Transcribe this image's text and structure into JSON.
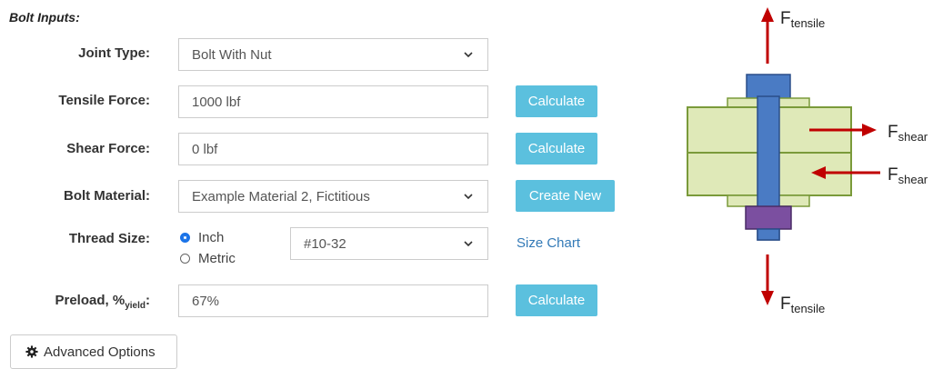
{
  "section_title": "Bolt Inputs:",
  "joint_type": {
    "label": "Joint Type:",
    "value": "Bolt With Nut"
  },
  "tensile_force": {
    "label": "Tensile Force:",
    "value": "1000 lbf",
    "button": "Calculate"
  },
  "shear_force": {
    "label": "Shear Force:",
    "value": "0 lbf",
    "button": "Calculate"
  },
  "bolt_material": {
    "label": "Bolt Material:",
    "value": "Example Material 2, Fictitious",
    "button": "Create New"
  },
  "thread_size": {
    "label": "Thread Size:",
    "radio_inch": "Inch",
    "radio_metric": "Metric",
    "selected_unit": "Inch",
    "value": "#10-32",
    "link": "Size Chart"
  },
  "preload": {
    "label_main": "Preload, %",
    "label_sub": "yield",
    "label_colon": ":",
    "value": "67%",
    "button": "Calculate"
  },
  "advanced_options": {
    "label": "Advanced Options",
    "icon": "gear-icon"
  },
  "diagram": {
    "f_main": "F",
    "sub_tensile": "tensile",
    "sub_shear": "shear"
  },
  "colors": {
    "button_bg": "#5bc0de",
    "link": "#337ab7",
    "arrow": "#c00000",
    "bolt": "#4a7bc4",
    "nut": "#7b4fa0",
    "plate_fill": "#dfe9b8",
    "plate_border": "#7a9a3a"
  }
}
